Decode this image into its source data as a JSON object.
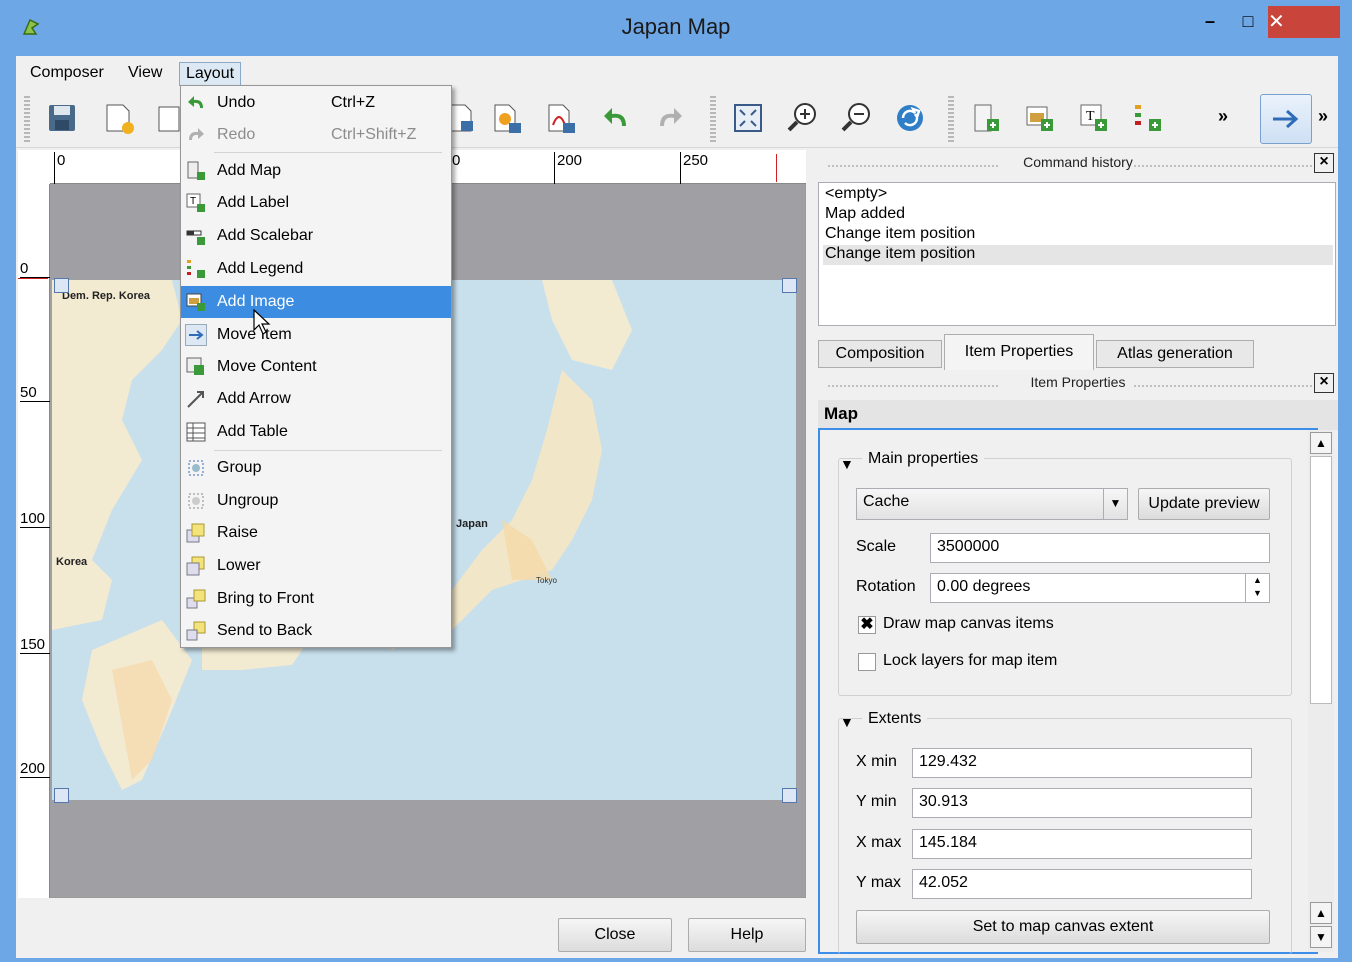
{
  "window": {
    "title": "Japan Map",
    "minimize": "–",
    "maximize": "□",
    "close": "✕"
  },
  "menubar": {
    "items": [
      "Composer",
      "View",
      "Layout"
    ]
  },
  "toolbar": {
    "overflow1": "»",
    "overflow2": "»"
  },
  "ruler": {
    "h_ticks": [
      "0",
      "0",
      "200",
      "250"
    ],
    "v_ticks": [
      "0",
      "50",
      "100",
      "150",
      "200"
    ]
  },
  "map": {
    "labels": [
      "Dem. Rep. Korea",
      "Korea",
      "Japan"
    ],
    "cities": [
      "Tokyo"
    ]
  },
  "layout_menu": {
    "items": [
      {
        "label": "Undo",
        "shortcut": "Ctrl+Z",
        "icon": "undo-icon",
        "enabled": true
      },
      {
        "label": "Redo",
        "shortcut": "Ctrl+Shift+Z",
        "icon": "redo-icon",
        "enabled": false
      },
      {
        "label": "Add Map",
        "icon": "add-map-icon"
      },
      {
        "label": "Add Label",
        "icon": "add-label-icon"
      },
      {
        "label": "Add Scalebar",
        "icon": "add-scalebar-icon"
      },
      {
        "label": "Add Legend",
        "icon": "add-legend-icon"
      },
      {
        "label": "Add Image",
        "icon": "add-image-icon",
        "highlighted": true
      },
      {
        "label": "Move Item",
        "icon": "move-item-icon"
      },
      {
        "label": "Move Content",
        "icon": "move-content-icon"
      },
      {
        "label": "Add Arrow",
        "icon": "add-arrow-icon"
      },
      {
        "label": "Add Table",
        "icon": "add-table-icon"
      },
      {
        "label": "Group",
        "icon": "group-icon"
      },
      {
        "label": "Ungroup",
        "icon": "ungroup-icon"
      },
      {
        "label": "Raise",
        "icon": "raise-icon"
      },
      {
        "label": "Lower",
        "icon": "lower-icon"
      },
      {
        "label": "Bring to Front",
        "icon": "bring-to-front-icon"
      },
      {
        "label": "Send to Back",
        "icon": "send-to-back-icon"
      }
    ]
  },
  "command_history": {
    "title": "Command history",
    "items": [
      "<empty>",
      "Map added",
      "Change item position",
      "Change item position"
    ]
  },
  "tabs": [
    "Composition",
    "Item Properties",
    "Atlas generation"
  ],
  "item_properties": {
    "title": "Item Properties",
    "item_type": "Map",
    "main_properties": {
      "title": "Main properties",
      "preview_mode": "Cache",
      "update_preview": "Update preview",
      "scale_label": "Scale",
      "scale_value": "3500000",
      "rotation_label": "Rotation",
      "rotation_value": "0.00 degrees",
      "draw_canvas_items": "Draw map canvas items",
      "lock_layers": "Lock layers for map item"
    },
    "extents": {
      "title": "Extents",
      "xmin_label": "X min",
      "xmin": "129.432",
      "ymin_label": "Y min",
      "ymin": "30.913",
      "xmax_label": "X max",
      "xmax": "145.184",
      "ymax_label": "Y max",
      "ymax": "42.052",
      "set_extent": "Set to map canvas extent"
    }
  },
  "bottom": {
    "close": "Close",
    "help": "Help"
  }
}
